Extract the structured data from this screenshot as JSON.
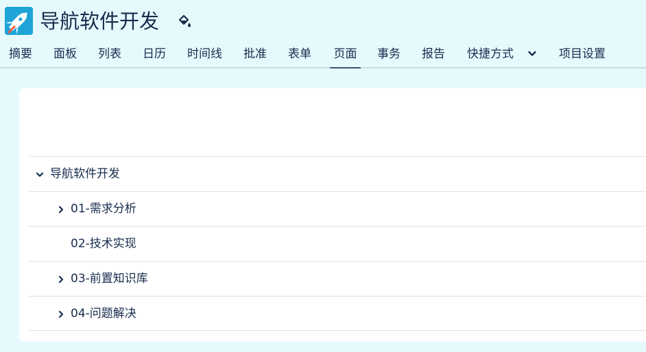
{
  "header": {
    "title": "导航软件开发",
    "logo_icon": "rocket-icon",
    "customize_icon": "paint-bucket-icon"
  },
  "nav": {
    "tabs": [
      {
        "label": "摘要"
      },
      {
        "label": "面板"
      },
      {
        "label": "列表"
      },
      {
        "label": "日历"
      },
      {
        "label": "时间线"
      },
      {
        "label": "批准"
      },
      {
        "label": "表单"
      },
      {
        "label": "页面",
        "active": true
      },
      {
        "label": "事务"
      },
      {
        "label": "报告"
      },
      {
        "label": "快捷方式"
      },
      {
        "label": "项目设置"
      }
    ],
    "shortcuts_icon": "chevron-down-icon"
  },
  "pages_tree": {
    "root": {
      "label": "导航软件开发",
      "expanded": true
    },
    "children": [
      {
        "label": "01-需求分析",
        "has_children": true
      },
      {
        "label": "02-技术实现",
        "has_children": false
      },
      {
        "label": "03-前置知识库",
        "has_children": true
      },
      {
        "label": "04-问题解决",
        "has_children": true
      }
    ]
  },
  "colors": {
    "page_background": "#e6fafd",
    "panel_background": "#ffffff",
    "text": "#172b4d",
    "logo": "#1fa4d8"
  }
}
